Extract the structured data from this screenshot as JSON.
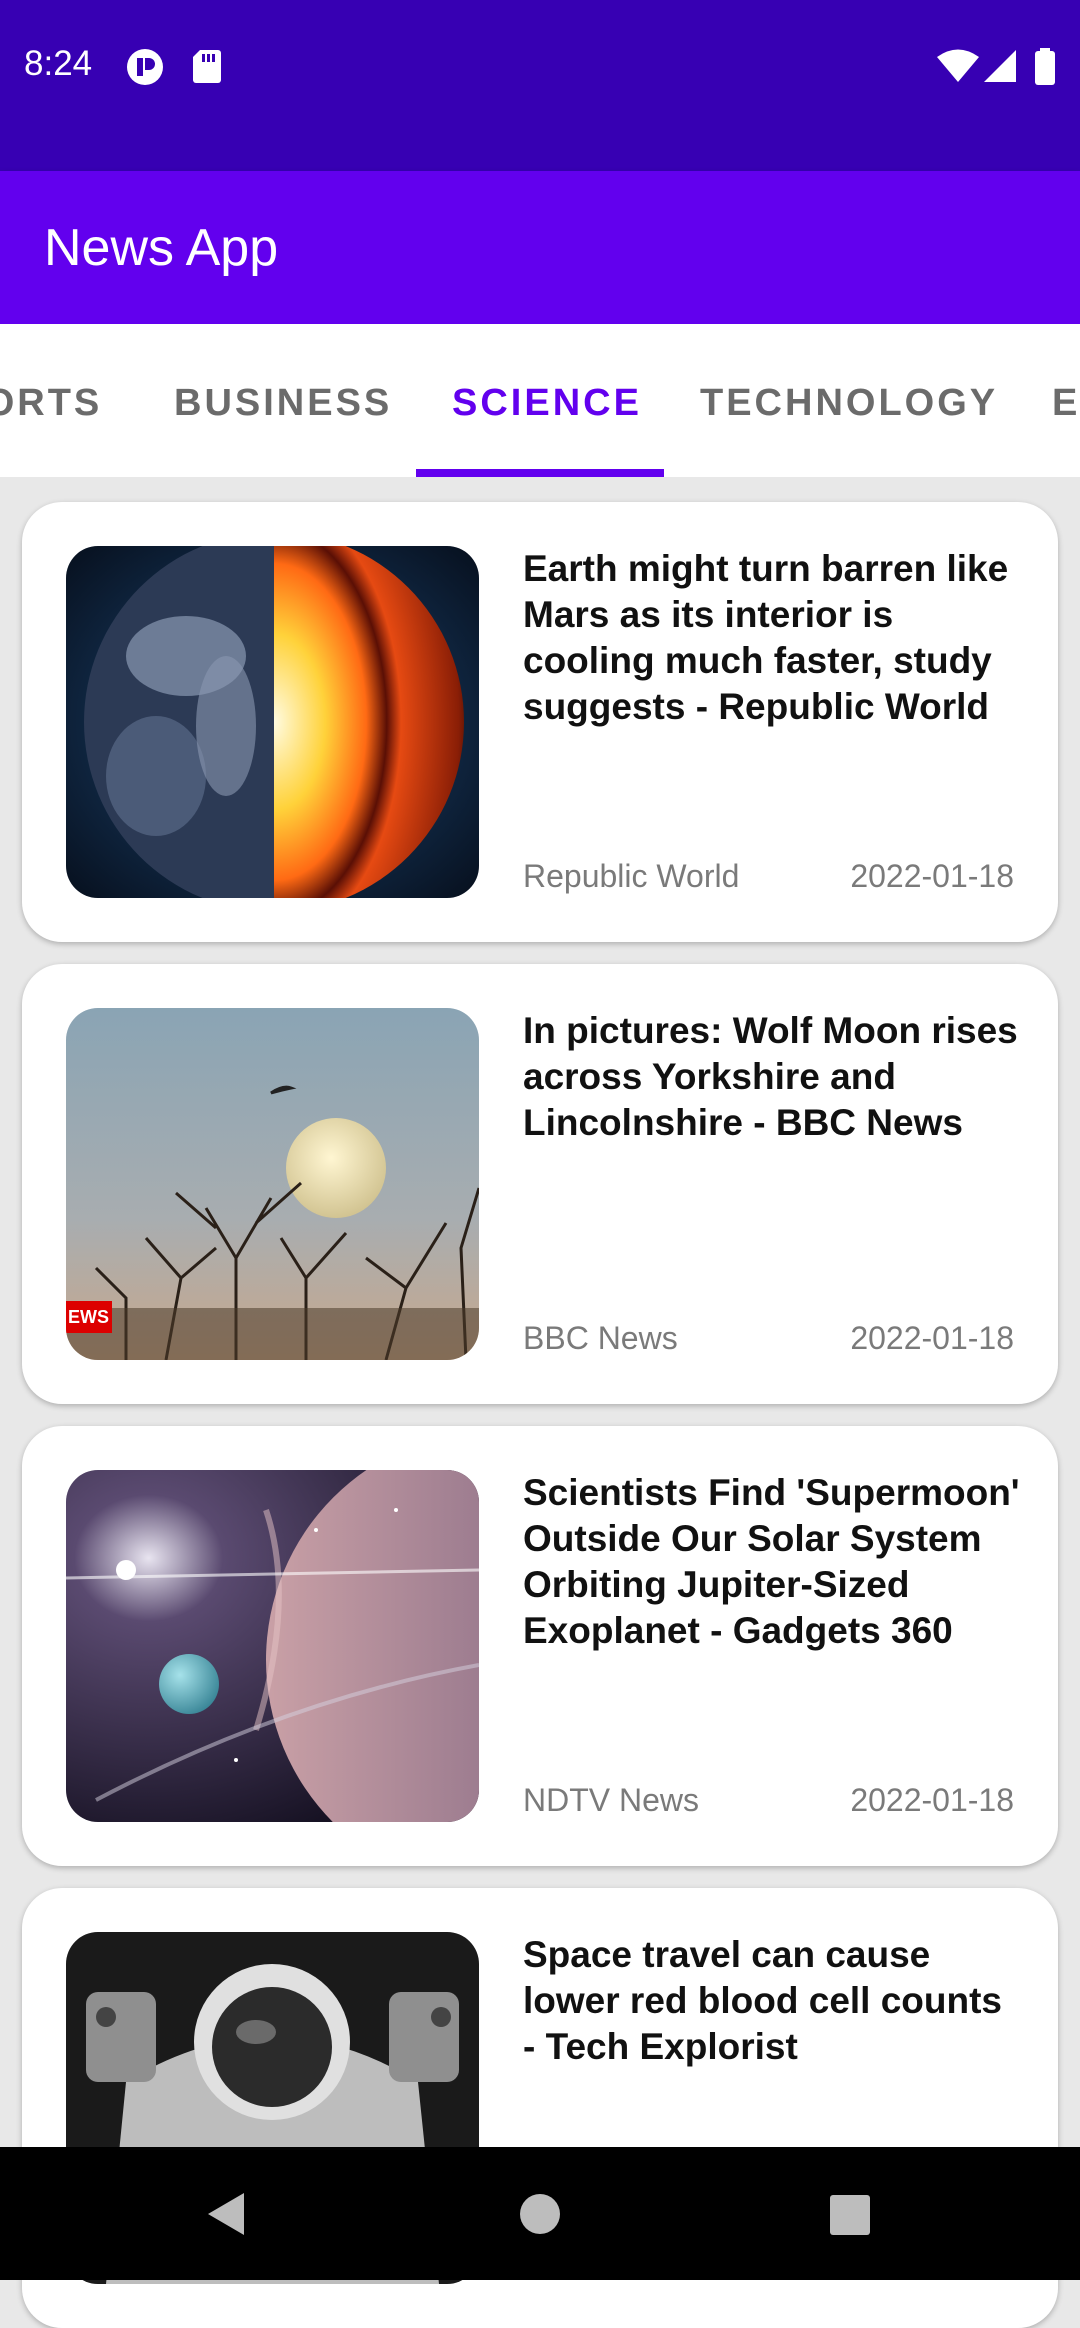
{
  "status_bar": {
    "time": "8:24"
  },
  "app_bar": {
    "title": "News App"
  },
  "tabs": [
    {
      "label": "SPORTS",
      "active": false
    },
    {
      "label": "BUSINESS",
      "active": false
    },
    {
      "label": "SCIENCE",
      "active": true
    },
    {
      "label": "TECHNOLOGY",
      "active": false
    },
    {
      "label": "ENTERTAINMENT",
      "active": false
    }
  ],
  "articles": [
    {
      "title": "Earth might turn barren like Mars as its interior is cooling much faster, study suggests - Republic World",
      "source": "Republic World",
      "date": "2022-01-18",
      "image": "earth-core-image"
    },
    {
      "title": "In pictures: Wolf Moon rises across Yorkshire and Lincolnshire - BBC News",
      "source": "BBC News",
      "date": "2022-01-18",
      "image": "moon-tree-image",
      "image_badge": "EWS"
    },
    {
      "title": "Scientists Find 'Supermoon' Outside Our Solar System Orbiting Jupiter-Sized Exoplanet - Gadgets 360",
      "source": "NDTV News",
      "date": "2022-01-18",
      "image": "exoplanet-image"
    },
    {
      "title": "Space travel can cause lower red blood cell counts - Tech Explorist",
      "source": "",
      "date": "",
      "image": "astronaut-image"
    }
  ],
  "colors": {
    "status_bar": "#3700b3",
    "app_bar": "#6200ee",
    "tab_active": "#6200ee",
    "tab_inactive": "#6b6b6b",
    "background": "#e8e8e8"
  }
}
